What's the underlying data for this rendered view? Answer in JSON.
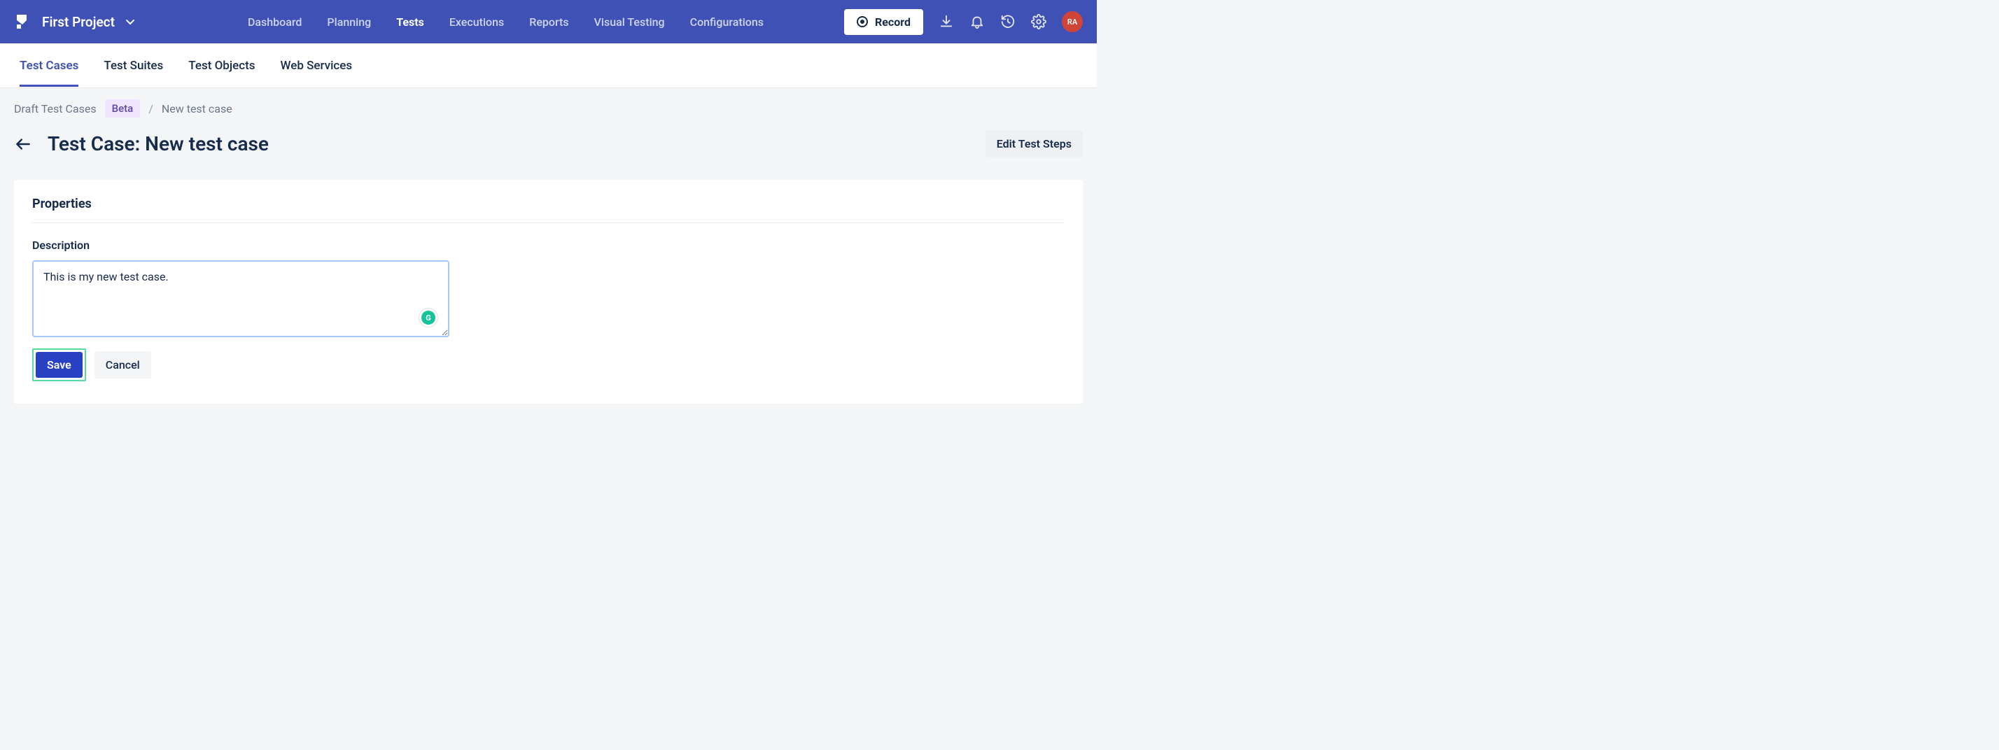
{
  "navbar": {
    "project_name": "First Project",
    "items": [
      {
        "label": "Dashboard",
        "active": false
      },
      {
        "label": "Planning",
        "active": false
      },
      {
        "label": "Tests",
        "active": true
      },
      {
        "label": "Executions",
        "active": false
      },
      {
        "label": "Reports",
        "active": false
      },
      {
        "label": "Visual Testing",
        "active": false
      },
      {
        "label": "Configurations",
        "active": false
      }
    ],
    "record_label": "Record",
    "avatar_initials": "RA"
  },
  "subtabs": [
    {
      "label": "Test Cases",
      "active": true
    },
    {
      "label": "Test Suites",
      "active": false
    },
    {
      "label": "Test Objects",
      "active": false
    },
    {
      "label": "Web Services",
      "active": false
    }
  ],
  "breadcrumb": {
    "root": "Draft Test Cases",
    "badge": "Beta",
    "current": "New test case"
  },
  "page": {
    "title": "Test Case: New test case",
    "edit_steps_label": "Edit Test Steps"
  },
  "properties": {
    "section_title": "Properties",
    "description_label": "Description",
    "description_value": "This is my new test case.",
    "save_label": "Save",
    "cancel_label": "Cancel",
    "grammarly_letter": "G"
  }
}
